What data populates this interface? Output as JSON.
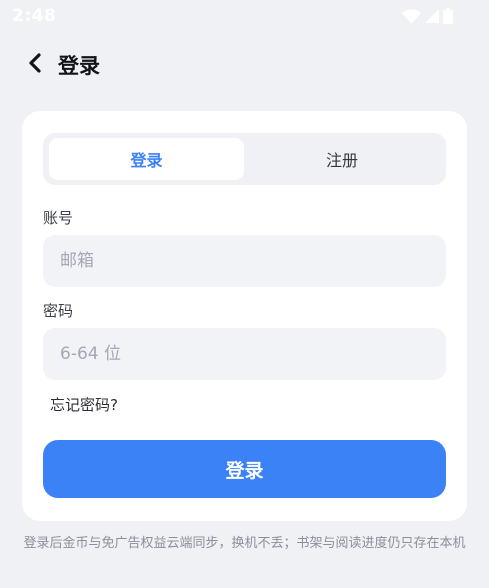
{
  "status_bar": {
    "time": "2:48",
    "icons": [
      "wifi-icon",
      "signal-icon",
      "battery-icon"
    ]
  },
  "header": {
    "back_icon": "chevron-left-icon",
    "title": "登录"
  },
  "tabs": {
    "login_label": "登录",
    "register_label": "注册",
    "active": "login"
  },
  "form": {
    "account_label": "账号",
    "account_value": "",
    "account_placeholder": "邮箱",
    "password_label": "密码",
    "password_value": "",
    "password_placeholder": "6-64 位",
    "forgot_label": "忘记密码?",
    "submit_label": "登录"
  },
  "footer": {
    "note": "登录后金币与免广告权益云端同步，换机不丢；书架与阅读进度仍只存在本机"
  },
  "colors": {
    "accent": "#3b82f6",
    "background": "#eff1f5",
    "card": "#ffffff",
    "input_bg": "#f2f3f7"
  }
}
